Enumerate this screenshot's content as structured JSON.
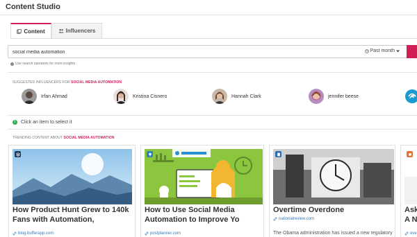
{
  "app": {
    "title": "Content Studio"
  },
  "tabs": [
    {
      "label": "Content",
      "icon": "content-icon",
      "active": true
    },
    {
      "label": "Influencers",
      "icon": "users-icon",
      "active": false
    }
  ],
  "search": {
    "value": "social media automation",
    "time_filter": "Past month",
    "hint": "Use search operators for more insights"
  },
  "influencers_section": {
    "prefix": "SUGGESTED INFLUENCERS FOR",
    "highlight": "SOCIAL MEDIA AUTOMATION",
    "items": [
      {
        "name": "Irfan Ahmad"
      },
      {
        "name": "Kristina Cisnero"
      },
      {
        "name": "Hannah Clark"
      },
      {
        "name": "jennifer beese"
      }
    ]
  },
  "select_prompt": "Click an item to select it",
  "trending_section": {
    "prefix": "TRENDING CONTENT ABOUT",
    "highlight": "SOCIAL MEDIA AUTOMATION"
  },
  "cards": [
    {
      "title": "How Product Hunt Grew to 140k",
      "title2": "Fans with Automation,",
      "source": "blog.bufferapp.com",
      "badge_color": "#1f3b5c"
    },
    {
      "title": "How to Use Social Media",
      "title2": "Automation to Improve Yo",
      "source": "postplanner.com",
      "badge_color": "#2f7fb8"
    },
    {
      "title": "Overtime Overdone",
      "title2": "",
      "source": "nationalreview.com",
      "description": "The Obama administration has issued a new regulatory",
      "badge_color": "#2f6db0"
    },
    {
      "title": "Ask",
      "title2": "A N",
      "source": "ever",
      "badge_color": "#e8742a"
    }
  ],
  "colors": {
    "accent": "#d21e55",
    "link": "#3a7ab8"
  }
}
